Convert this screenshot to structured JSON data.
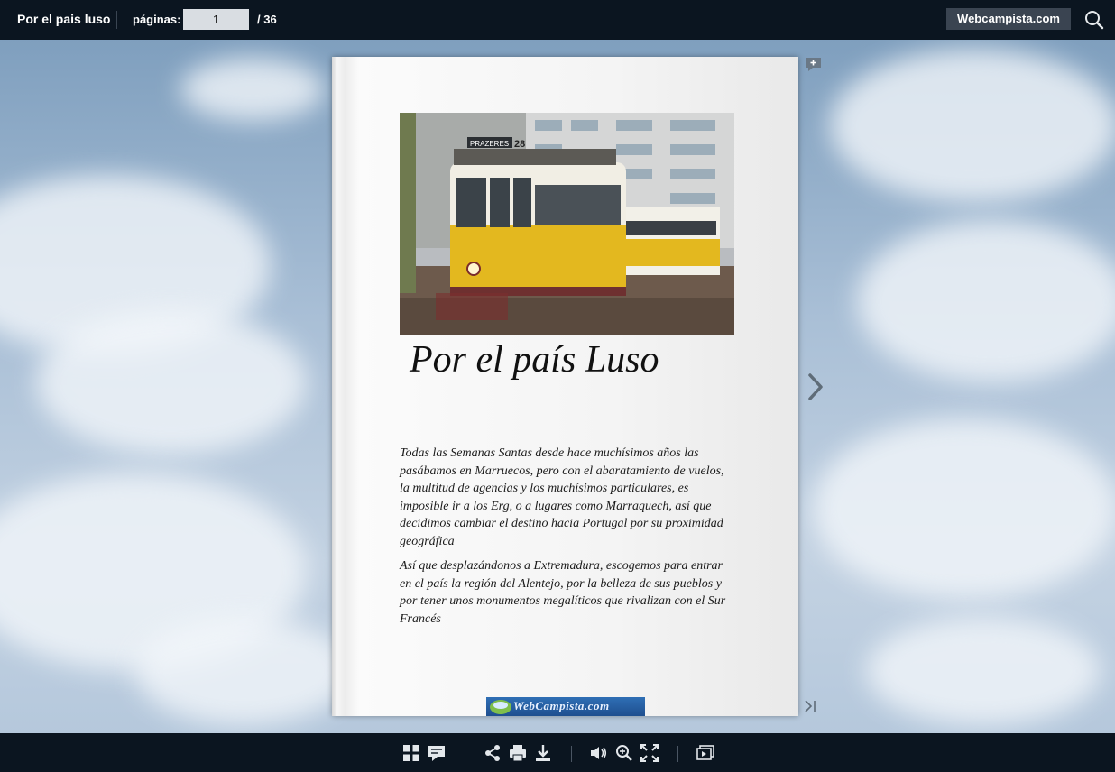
{
  "header": {
    "title": "Por el pais luso",
    "pages_label": "páginas:",
    "current_page": "1",
    "total_pages": "/ 36",
    "site_button": "Webcampista.com",
    "search_icon": "search-icon"
  },
  "page": {
    "heading": "Por el país Luso",
    "tram_number": "28",
    "tram_sign": "PRAZERES",
    "paragraphs": [
      "Todas las  Semanas Santas desde hace muchísimos años las pasábamos en Marruecos, pero con el abaratamiento de vuelos, la multitud de agencias y los muchísimos particulares, es imposible ir a los Erg, o a lugares como Marraquech, así que decidimos cambiar el destino hacia Portugal por su proximidad geográfica",
      "Así que desplazándonos a Extremadura, escogemos para entrar en el país la región del Alentejo, por la belleza de sus pueblos y por tener unos monumentos megalíticos que rivalizan con el Sur Francés"
    ],
    "logo_text": "WebCampista.com"
  },
  "navigation": {
    "next_icon": "chevron-right-icon",
    "last_icon": "last-page-icon",
    "note_icon": "add-note-icon"
  },
  "toolbar": {
    "icons": [
      "thumbnails-icon",
      "comments-icon",
      "share-icon",
      "print-icon",
      "download-icon",
      "sound-icon",
      "zoom-in-icon",
      "fullscreen-icon",
      "slideshow-icon"
    ]
  },
  "colors": {
    "bar_bg": "#0b1520",
    "site_button_bg": "#3a4451",
    "tram_yellow": "#e3b81f"
  }
}
